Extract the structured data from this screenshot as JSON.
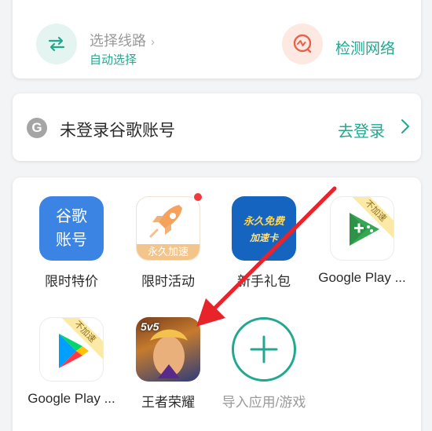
{
  "route": {
    "title": "选择线路",
    "chevron": "›",
    "subtitle": "自动选择",
    "icon": "route-switch-icon"
  },
  "detect": {
    "label": "检测网络",
    "icon": "network-detect-icon"
  },
  "google": {
    "icon_letter": "G",
    "status": "未登录谷歌账号",
    "login_label": "去登录",
    "chevron": "›"
  },
  "apps": [
    {
      "label": "限时特价",
      "icon_text_top": "谷歌",
      "icon_text_bottom": "账号"
    },
    {
      "label": "限时活动",
      "icon_strip": "永久加速",
      "badge": "new-dot"
    },
    {
      "label": "新手礼包",
      "icon_text_top": "永久免费",
      "icon_text_bottom": "加速卡"
    },
    {
      "label": "Google Play ...",
      "corner_tag": "不加速"
    },
    {
      "label": "Google Play ...",
      "corner_tag": "不加速"
    },
    {
      "label": "王者荣耀",
      "icon_text": "5v5"
    },
    {
      "label": "导入应用/游戏"
    }
  ],
  "colors": {
    "accent": "#22a88f",
    "blue_app": "#3c84e3",
    "badge_red": "#ef3b3b",
    "arrow_red": "#e8242a"
  }
}
